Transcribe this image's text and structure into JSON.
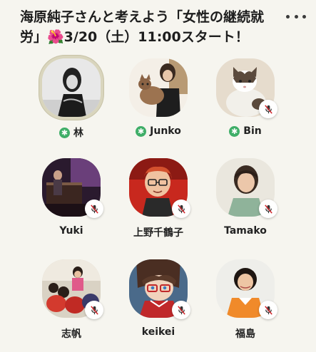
{
  "room": {
    "title_line1": "海原純子さんと考えよう「女性の継続就",
    "title_line2": "労」🌺3/20（土）11:00スタート！"
  },
  "speakers": [
    {
      "name": "林",
      "moderator": true,
      "muted": false
    },
    {
      "name": "Junko",
      "moderator": true,
      "muted": false
    },
    {
      "name": "Bin",
      "moderator": true,
      "muted": true
    },
    {
      "name": "Yuki",
      "moderator": false,
      "muted": true
    },
    {
      "name": "上野千鶴子",
      "moderator": false,
      "muted": true
    },
    {
      "name": "Tamako",
      "moderator": false,
      "muted": true
    },
    {
      "name": "志帆",
      "moderator": false,
      "muted": true
    },
    {
      "name": "keikei",
      "moderator": false,
      "muted": true
    },
    {
      "name": "福島",
      "moderator": false,
      "muted": true
    }
  ],
  "colors": {
    "background": "#f6f5ef",
    "moderator_badge": "#3fae68",
    "mute_icon": "#d0252a"
  },
  "icons": {
    "more": "more-dots-icon",
    "moderator": "moderator-star-icon",
    "mute": "mic-muted-icon"
  }
}
